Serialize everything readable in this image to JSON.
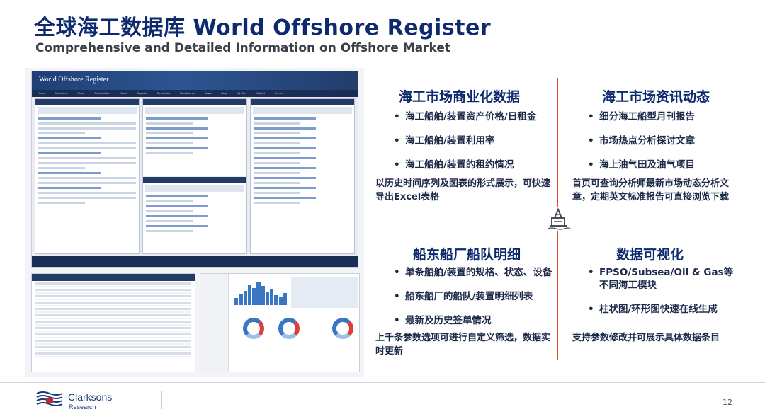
{
  "header": {
    "title": "全球海工数据库 World Offshore Register",
    "subtitle": "Comprehensive and Detailed Information on Offshore Market"
  },
  "screenshot": {
    "logo": "World Offshore Register",
    "nav_items": [
      "Home",
      "Structures",
      "Fields",
      "Shareholders",
      "Maps",
      "Reports",
      "Timeseries",
      "Dashboards",
      "News",
      "Help",
      "My Files",
      "Market",
      "Prices"
    ]
  },
  "sections": {
    "commercial": {
      "title": "海工市场商业化数据",
      "bullets": [
        "海工船舶/装置资产价格/日租金",
        "海工船舶/装置利用率",
        "海工船舶/装置的租约情况"
      ],
      "note": "以历史时间序列及图表的形式展示，可快速导出Excel表格"
    },
    "news": {
      "title": "海工市场资讯动态",
      "bullets": [
        "细分海工船型月刊报告",
        "市场热点分析探讨文章",
        "海上油气田及油气项目"
      ],
      "note": "首页可查询分析师最新市场动态分析文章，定期英文标准报告可直接浏览下载"
    },
    "fleet": {
      "title": "船东船厂船队明细",
      "bullets": [
        "单条船舶/装置的规格、状态、设备",
        "船东船厂的船队/装置明细列表",
        "最新及历史签单情况"
      ],
      "note": "上千条参数选项可进行自定义筛选，数据实时更新"
    },
    "visual": {
      "title": "数据可视化",
      "bullets": [
        "FPSO/Subsea/Oil & Gas等不同海工模块",
        "柱状图/环形图快速在线生成"
      ],
      "note": "支持参数修改并可展示具体数据条目"
    }
  },
  "footer": {
    "brand_name": "Clarksons",
    "brand_sub": "Research",
    "page_number": "12"
  },
  "colors": {
    "title_blue": "#0d2a6e",
    "divider_red": "#e34a2a"
  }
}
